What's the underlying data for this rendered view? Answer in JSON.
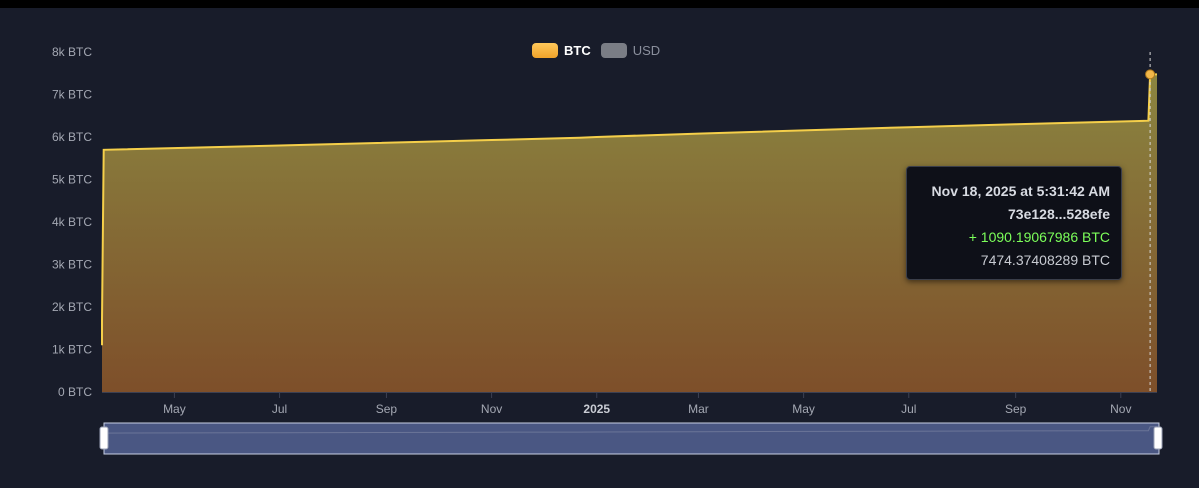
{
  "legend": {
    "btc_label": "BTC",
    "usd_label": "USD",
    "btc_color": "#f7b13a",
    "usd_color": "#7a7d85"
  },
  "tooltip": {
    "date": "Nov 18, 2025 at 5:31:42 AM",
    "tx": "73e128...528efe",
    "delta": "+ 1090.19067986 BTC",
    "total": "7474.37408289 BTC",
    "delta_color": "#7cff5a"
  },
  "chart_data": {
    "type": "area",
    "series": [
      {
        "name": "BTC"
      }
    ],
    "y_unit": "BTC",
    "ylim": [
      0,
      8000
    ],
    "y_ticks": [
      {
        "value": 0,
        "label": "0 BTC"
      },
      {
        "value": 1000,
        "label": "1k BTC"
      },
      {
        "value": 2000,
        "label": "2k BTC"
      },
      {
        "value": 3000,
        "label": "3k BTC"
      },
      {
        "value": 4000,
        "label": "4k BTC"
      },
      {
        "value": 5000,
        "label": "5k BTC"
      },
      {
        "value": 6000,
        "label": "6k BTC"
      },
      {
        "value": 7000,
        "label": "7k BTC"
      },
      {
        "value": 8000,
        "label": "8k BTC"
      }
    ],
    "xlim": [
      "2024-03-20",
      "2025-11-22"
    ],
    "x_ticks": [
      {
        "date": "2024-05-01",
        "label": "May",
        "bold": false
      },
      {
        "date": "2024-07-01",
        "label": "Jul",
        "bold": false
      },
      {
        "date": "2024-09-01",
        "label": "Sep",
        "bold": false
      },
      {
        "date": "2024-11-01",
        "label": "Nov",
        "bold": false
      },
      {
        "date": "2025-01-01",
        "label": "2025",
        "bold": true
      },
      {
        "date": "2025-03-01",
        "label": "Mar",
        "bold": false
      },
      {
        "date": "2025-05-01",
        "label": "May",
        "bold": false
      },
      {
        "date": "2025-07-01",
        "label": "Jul",
        "bold": false
      },
      {
        "date": "2025-09-01",
        "label": "Sep",
        "bold": false
      },
      {
        "date": "2025-11-01",
        "label": "Nov",
        "bold": false
      }
    ],
    "points": [
      {
        "date": "2024-03-20",
        "value": 1100
      },
      {
        "date": "2024-03-20",
        "value": 1700
      },
      {
        "date": "2024-03-21",
        "value": 5700
      },
      {
        "date": "2024-07-01",
        "value": 5800
      },
      {
        "date": "2024-11-01",
        "value": 5930
      },
      {
        "date": "2024-12-22",
        "value": 5980
      },
      {
        "date": "2025-01-01",
        "value": 6000
      },
      {
        "date": "2025-03-01",
        "value": 6080
      },
      {
        "date": "2025-07-01",
        "value": 6230
      },
      {
        "date": "2025-09-01",
        "value": 6300
      },
      {
        "date": "2025-11-17",
        "value": 6384
      },
      {
        "date": "2025-11-18",
        "value": 7474
      },
      {
        "date": "2025-11-22",
        "value": 7474
      }
    ],
    "highlight": {
      "date": "2025-11-18",
      "value": 7474.37408289
    },
    "grid": false,
    "legend_position": "top-center"
  }
}
